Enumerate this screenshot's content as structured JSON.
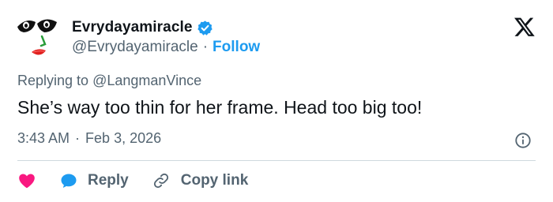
{
  "author": {
    "display_name": "Evrydayamiracle",
    "handle": "@Evrydayamiracle",
    "follow_label": "Follow",
    "verified_icon": "verified-badge-icon",
    "verified_color": "#1d9bf0"
  },
  "separator": "·",
  "reply_context": {
    "prefix": "Replying to",
    "mention": "@LangmanVince"
  },
  "tweet": {
    "text": "She’s way too thin for her frame. Head too big too!",
    "time": "3:43 AM",
    "date": "Feb 3, 2026"
  },
  "actions": {
    "like_icon": "heart-icon",
    "like_color": "#f91880",
    "reply_label": "Reply",
    "reply_icon": "speech-bubble-icon",
    "reply_color": "#1d9bf0",
    "copy_label": "Copy link",
    "copy_icon": "link-icon"
  },
  "icons": {
    "platform": "x-logo-icon",
    "info": "info-icon"
  },
  "colors": {
    "text": "#0f1419",
    "secondary": "#536471",
    "accent": "#1d9bf0",
    "divider": "#cfd9de"
  }
}
